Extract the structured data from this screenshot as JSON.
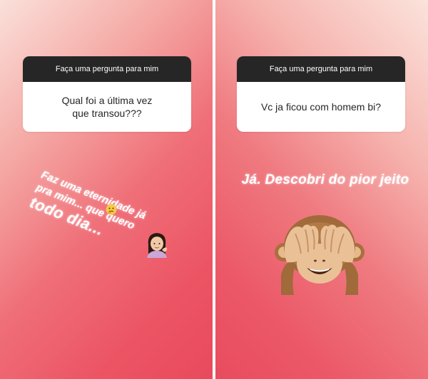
{
  "stories": [
    {
      "question_prompt": "Faça uma pergunta para mim",
      "question_text": "Qual foi a última vez\nque transou???",
      "answer_lines": [
        "Faz uma eternidade já",
        "pra mim...  que quero",
        "todo dia..."
      ],
      "emojis": [
        "thinking-face-icon",
        "woman-tipping-hand-icon"
      ]
    },
    {
      "question_prompt": "Faça uma pergunta para mim",
      "question_text": "Vc ja ficou com homem bi?",
      "answer_text": "Já. Descobri do pior jeito",
      "emojis": [
        "see-no-evil-monkey-icon"
      ]
    }
  ],
  "colors": {
    "gradient_light": "#fbe0da",
    "gradient_dark": "#e84a5c",
    "header_bg": "#262626",
    "text_white": "#ffffff"
  }
}
